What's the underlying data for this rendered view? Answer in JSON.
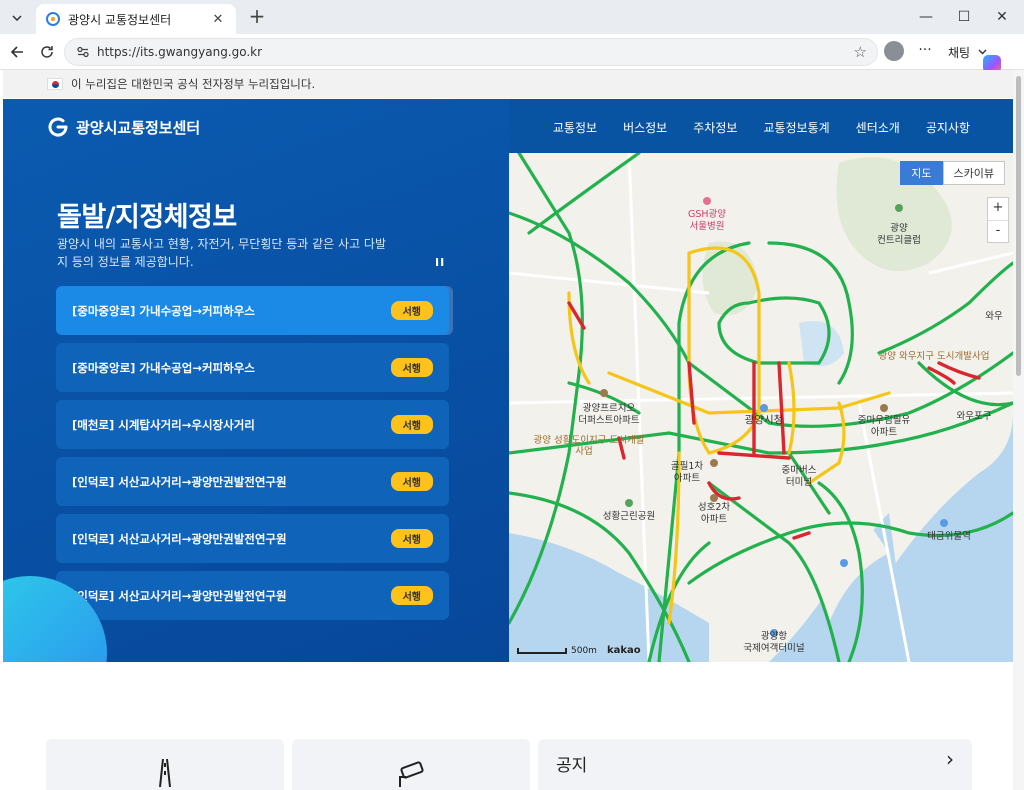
{
  "browser": {
    "tab_title": "광양시 교통정보센터",
    "url": "https://its.gwangyang.go.kr",
    "copilot_label": "채팅"
  },
  "gov_banner": {
    "text": "이 누리집은 대한민국 공식 전자정부 누리집입니다."
  },
  "header": {
    "logo_text": "광양시교통정보센터",
    "nav": [
      "교통정보",
      "버스정보",
      "주차정보",
      "교통정보통계",
      "센터소개",
      "공지사항"
    ]
  },
  "hero": {
    "title": "돌발/지정체정보",
    "description": "광양시 내의 교통사고 현황, 자전거, 무단횡단 등과 같은 사고 다발지 등의 정보를 제공합니다.",
    "pause_label": "II",
    "events": [
      {
        "text": "[중마중앙로] 가내수공업→커피하우스",
        "badge": "서행"
      },
      {
        "text": "[중마중앙로] 가내수공업→커피하우스",
        "badge": "서행"
      },
      {
        "text": "[매천로] 시계탑사거리→우시장사거리",
        "badge": "서행"
      },
      {
        "text": "[인덕로] 서산교사거리→광양만권발전연구원",
        "badge": "서행"
      },
      {
        "text": "[인덕로] 서산교사거리→광양만권발전연구원",
        "badge": "서행"
      },
      {
        "text": "[인덕로] 서산교사거리→광양만권발전연구원",
        "badge": "서행"
      }
    ]
  },
  "map": {
    "type_map": "지도",
    "type_sky": "스카이뷰",
    "zoom_in": "+",
    "zoom_out": "-",
    "scale_label": "500m",
    "provider": "kakao",
    "labels": [
      "GSH광양",
      "서울병원",
      "광양",
      "컨트리클럽",
      "와우",
      "광양 와우지구 도시개발사업",
      "광양프르지오",
      "더퍼스트아파트",
      "광양 성황도이지구 도시개발",
      "사업",
      "광양시청",
      "중마우림필유",
      "아파트",
      "와우포구",
      "골필1차",
      "아파트",
      "중마버스",
      "터미널",
      "성황근린공원",
      "성호2차",
      "아파트",
      "태금위물역",
      "광양항",
      "국제여객터미널"
    ]
  },
  "bottom": {
    "notice_title": "공지",
    "notice_arrow": "›"
  },
  "colors": {
    "hero_bg": "#0854a3",
    "badge": "#ffc21a",
    "road_green": "#22b14c",
    "road_yellow": "#f5c518",
    "road_red": "#d9262f"
  }
}
